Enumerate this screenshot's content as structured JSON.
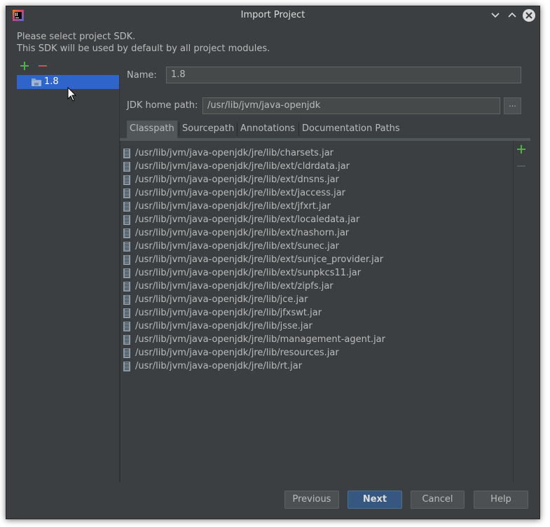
{
  "window": {
    "title": "Import Project"
  },
  "header": {
    "line1": "Please select project SDK.",
    "line2": "This SDK will be used by default by all project modules."
  },
  "sdk_list": {
    "items": [
      {
        "label": "1.8",
        "selected": true
      }
    ]
  },
  "form": {
    "name_label": "Name:",
    "name_value": "1.8",
    "jdk_label": "JDK home path:",
    "jdk_value": "/usr/lib/jvm/java-openjdk",
    "browse_label": "..."
  },
  "tabs": [
    {
      "label": "Classpath",
      "active": true
    },
    {
      "label": "Sourcepath",
      "active": false
    },
    {
      "label": "Annotations",
      "active": false
    },
    {
      "label": "Documentation Paths",
      "active": false
    }
  ],
  "classpath": [
    "/usr/lib/jvm/java-openjdk/jre/lib/charsets.jar",
    "/usr/lib/jvm/java-openjdk/jre/lib/ext/cldrdata.jar",
    "/usr/lib/jvm/java-openjdk/jre/lib/ext/dnsns.jar",
    "/usr/lib/jvm/java-openjdk/jre/lib/ext/jaccess.jar",
    "/usr/lib/jvm/java-openjdk/jre/lib/ext/jfxrt.jar",
    "/usr/lib/jvm/java-openjdk/jre/lib/ext/localedata.jar",
    "/usr/lib/jvm/java-openjdk/jre/lib/ext/nashorn.jar",
    "/usr/lib/jvm/java-openjdk/jre/lib/ext/sunec.jar",
    "/usr/lib/jvm/java-openjdk/jre/lib/ext/sunjce_provider.jar",
    "/usr/lib/jvm/java-openjdk/jre/lib/ext/sunpkcs11.jar",
    "/usr/lib/jvm/java-openjdk/jre/lib/ext/zipfs.jar",
    "/usr/lib/jvm/java-openjdk/jre/lib/jce.jar",
    "/usr/lib/jvm/java-openjdk/jre/lib/jfxswt.jar",
    "/usr/lib/jvm/java-openjdk/jre/lib/jsse.jar",
    "/usr/lib/jvm/java-openjdk/jre/lib/management-agent.jar",
    "/usr/lib/jvm/java-openjdk/jre/lib/resources.jar",
    "/usr/lib/jvm/java-openjdk/jre/lib/rt.jar"
  ],
  "buttons": {
    "previous": "Previous",
    "next": "Next",
    "cancel": "Cancel",
    "help": "Help"
  },
  "icons": {
    "app": "intellij-idea-icon",
    "minimize": "chevron-down-icon",
    "maximize": "chevron-up-icon",
    "close": "close-icon",
    "add": "plus-icon",
    "remove": "minus-icon",
    "sdk": "folder-icon",
    "jar": "jar-icon",
    "cursor": "mouse-pointer-icon"
  },
  "colors": {
    "background": "#3c3f41",
    "selection": "#2f65ca",
    "default_button": "#365880",
    "add": "#4fb249",
    "remove": "#c75450"
  }
}
